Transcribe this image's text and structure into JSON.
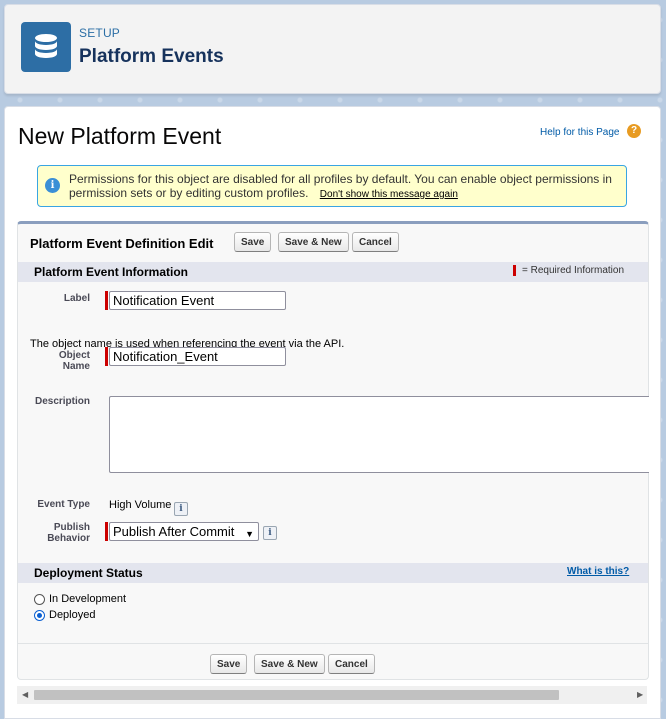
{
  "header": {
    "setup_label": "SETUP",
    "title": "Platform Events",
    "icon": "database-icon"
  },
  "page": {
    "title": "New Platform Event",
    "help_link": "Help for this Page",
    "help_icon": "?"
  },
  "info": {
    "message": "Permissions for this object are disabled for all profiles by default. You can enable object permissions in permission sets or by editing custom profiles.",
    "dismiss_link": "Don't show this message again",
    "icon_glyph": "i"
  },
  "edit_block": {
    "title": "Platform Event Definition Edit",
    "buttons": {
      "save": "Save",
      "save_new": "Save & New",
      "cancel": "Cancel"
    }
  },
  "info_section": {
    "title": "Platform Event Information",
    "required_legend": "= Required Information"
  },
  "fields": {
    "label": {
      "label": "Label",
      "value": "Notification Event"
    },
    "api_note": "The object name is used when referencing the event via the API.",
    "object_name": {
      "label_line1": "Object",
      "label_line2": "Name",
      "value": "Notification_Event"
    },
    "description": {
      "label": "Description",
      "value": ""
    },
    "event_type": {
      "label": "Event Type",
      "value": "High Volume"
    },
    "publish_behavior": {
      "label_line1": "Publish",
      "label_line2": "Behavior",
      "value": "Publish After Commit"
    }
  },
  "deployment": {
    "title": "Deployment Status",
    "what_link": "What is this?",
    "options": [
      {
        "label": "In Development",
        "selected": false
      },
      {
        "label": "Deployed",
        "selected": true
      }
    ]
  },
  "bottom_buttons": {
    "save": "Save",
    "save_new": "Save & New",
    "cancel": "Cancel"
  },
  "colors": {
    "brand_icon": "#2d6ea5",
    "required": "#cc0000",
    "link": "#015ba7",
    "info_bg": "#ffffcc"
  }
}
